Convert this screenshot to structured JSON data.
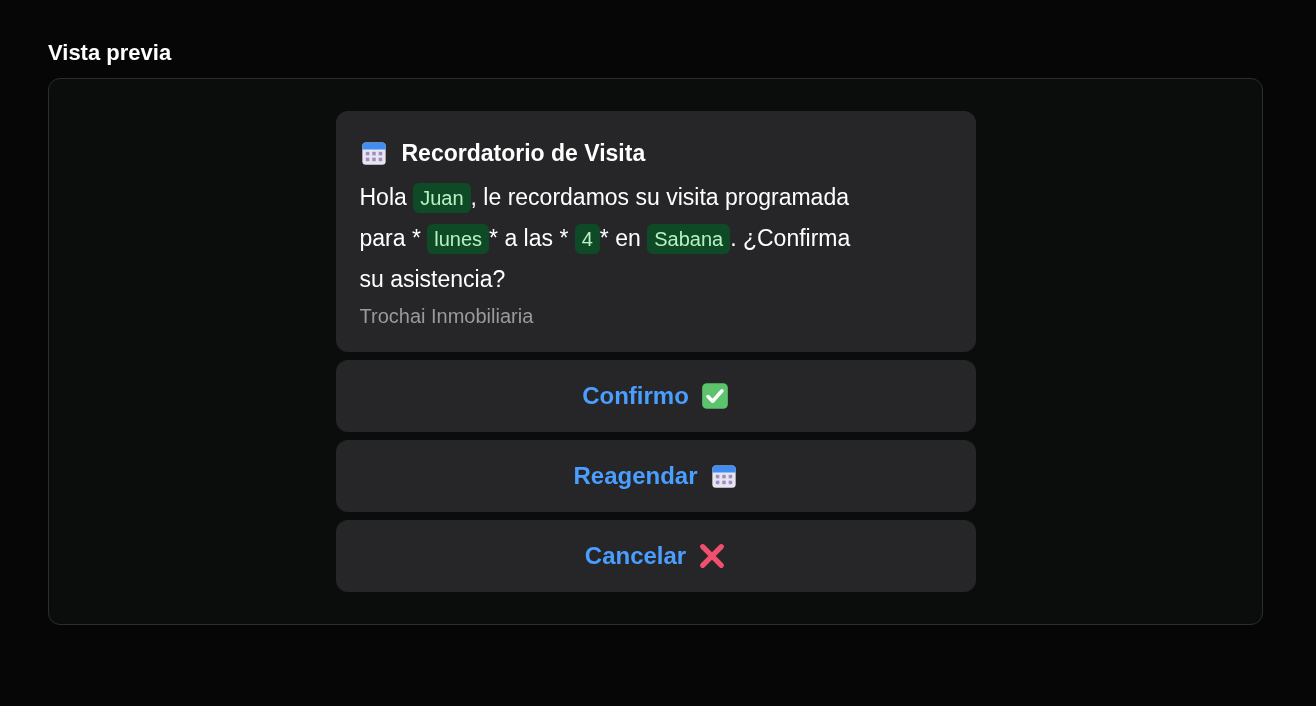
{
  "heading": "Vista previa",
  "card": {
    "title": "Recordatorio de Visita",
    "message_lines": [
      [
        {
          "kind": "text",
          "text": "Hola "
        },
        {
          "kind": "variable",
          "text": "Juan"
        },
        {
          "kind": "text",
          "text": ", le recordamos su visita programada"
        }
      ],
      [
        {
          "kind": "text",
          "text": "para * "
        },
        {
          "kind": "variable",
          "text": "lunes"
        },
        {
          "kind": "text",
          "text": "* a las * "
        },
        {
          "kind": "variable",
          "text": "4"
        },
        {
          "kind": "text",
          "text": "* en "
        },
        {
          "kind": "variable",
          "text": "Sabana"
        },
        {
          "kind": "text",
          "text": ". ¿Confirma"
        }
      ],
      [
        {
          "kind": "text",
          "text": "su asistencia?"
        }
      ]
    ],
    "footer": "Trochai Inmobiliaria"
  },
  "buttons": [
    {
      "label": "Confirmo",
      "kind": "confirm"
    },
    {
      "label": "Reagendar",
      "kind": "reschedule"
    },
    {
      "label": "Cancelar",
      "kind": "cancel"
    }
  ]
}
